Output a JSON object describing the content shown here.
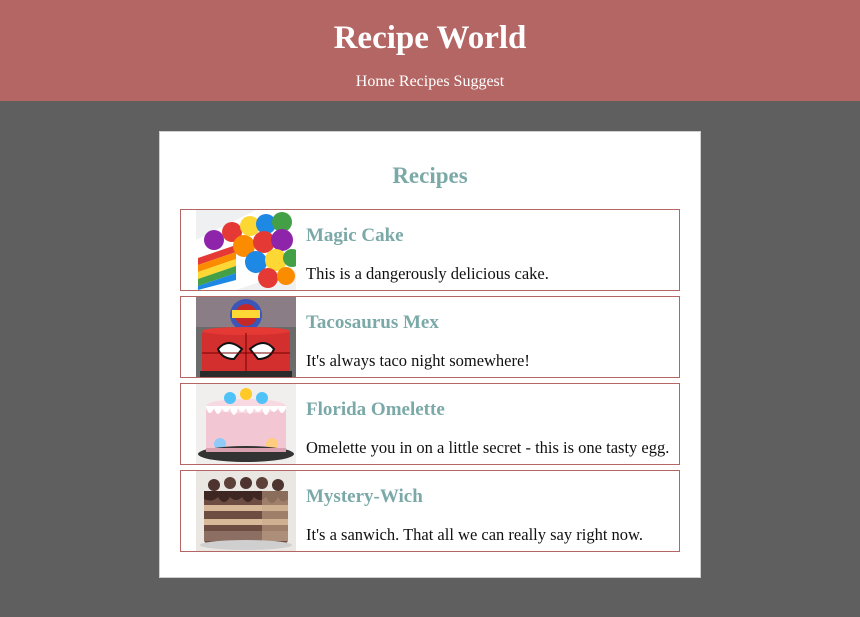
{
  "header": {
    "title": "Recipe World",
    "nav": [
      {
        "label": "Home"
      },
      {
        "label": "Recipes"
      },
      {
        "label": "Suggest"
      }
    ]
  },
  "main": {
    "title": "Recipes",
    "recipes": [
      {
        "name": "Magic Cake",
        "description": "This is a dangerously delicious cake.",
        "image": "rainbow-cake-image"
      },
      {
        "name": "Tacosaurus Mex",
        "description": "It's always taco night somewhere!",
        "image": "spiderman-cake-image"
      },
      {
        "name": "Florida Omelette",
        "description": "Omelette you in on a little secret - this is one tasty egg.",
        "image": "pink-drip-cake-image"
      },
      {
        "name": "Mystery-Wich",
        "description": "It's a sanwich. That all we can really say right now.",
        "image": "chocolate-cake-image"
      }
    ]
  },
  "colors": {
    "header_bg": "#b36663",
    "accent": "#7aa9a7",
    "page_bg": "#5f5f5f"
  }
}
